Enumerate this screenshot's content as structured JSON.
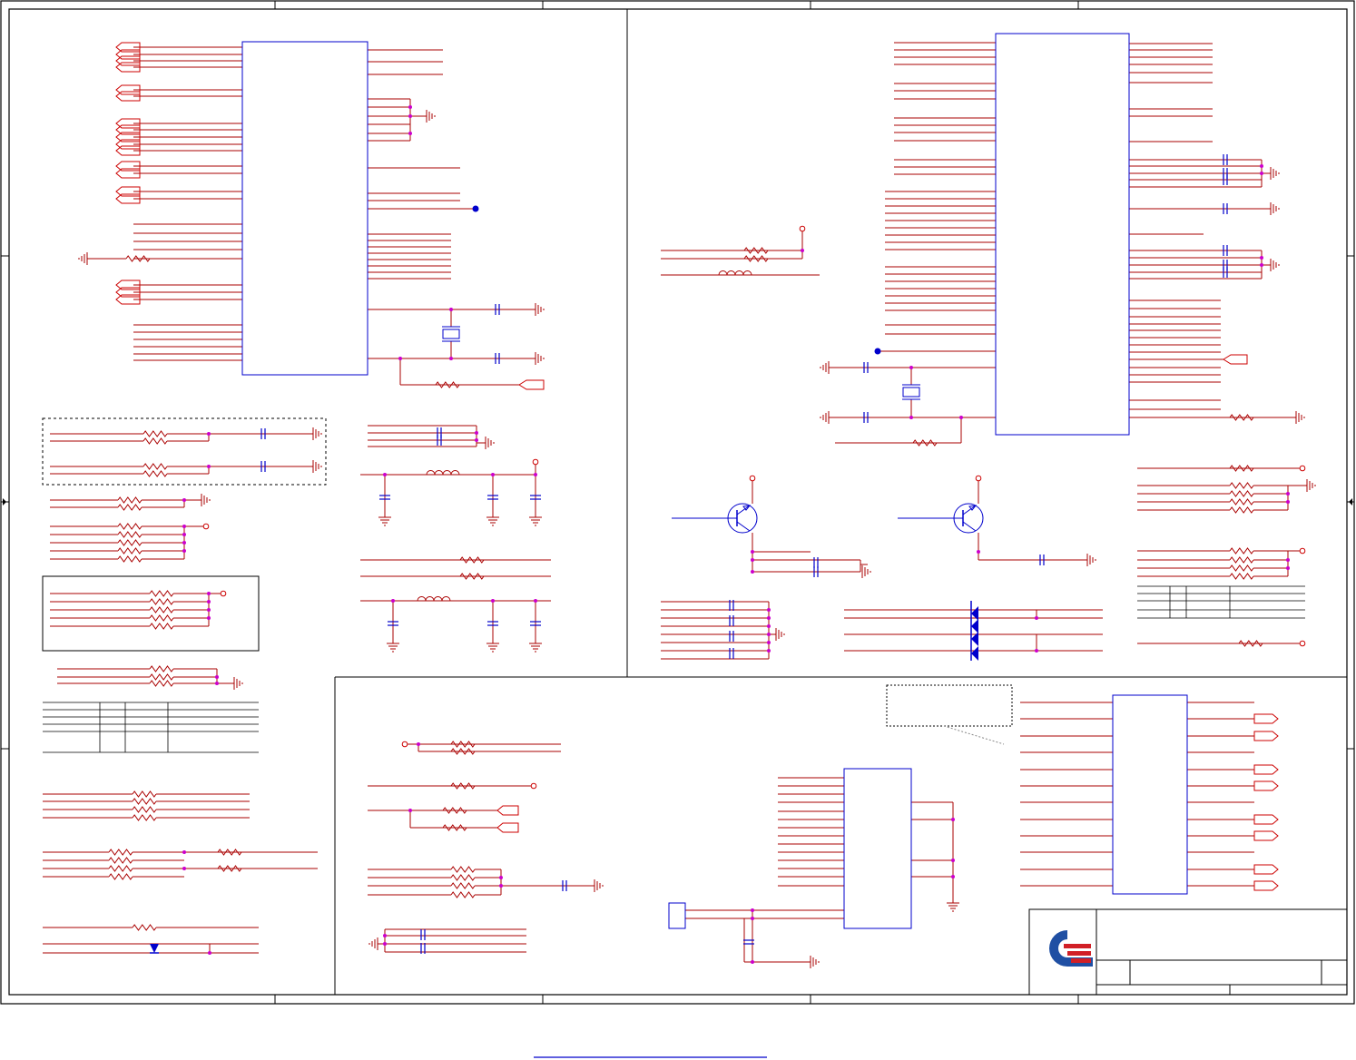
{
  "colors": {
    "border": "#000000",
    "wire": "#aa0000",
    "component": "#0000cc",
    "junction": "#cc00cc",
    "terminal": "#cc0000",
    "logo_blue": "#1f4fa3",
    "logo_red": "#d11f26"
  },
  "icons": {
    "logo": "company-logo-icon",
    "ground": "ground-icon",
    "resistor": "resistor-icon",
    "capacitor": "capacitor-icon",
    "inductor": "inductor-icon",
    "crystal": "crystal-icon",
    "transistor": "npn-transistor-icon",
    "diode": "diode-icon"
  }
}
